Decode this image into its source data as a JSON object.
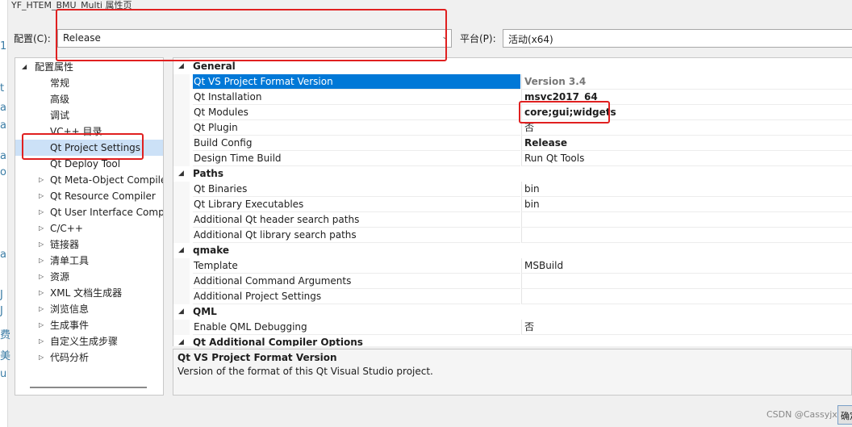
{
  "window": {
    "title": "YF_HTEM_BMU_Multi 属性页"
  },
  "config_bar": {
    "config_label": "配置(C):",
    "config_value": "Release",
    "platform_label": "平台(P):",
    "platform_value": "活动(x64)"
  },
  "tree": {
    "root": "配置属性",
    "items": [
      {
        "label": "常规"
      },
      {
        "label": "高级"
      },
      {
        "label": "调试"
      },
      {
        "label": "VC++ 目录"
      },
      {
        "label": "Qt Project Settings"
      },
      {
        "label": "Qt Deploy Tool"
      },
      {
        "label": "Qt Meta-Object Compiler"
      },
      {
        "label": "Qt Resource Compiler"
      },
      {
        "label": "Qt User Interface Compiler"
      },
      {
        "label": "C/C++"
      },
      {
        "label": "链接器"
      },
      {
        "label": "清单工具"
      },
      {
        "label": "资源"
      },
      {
        "label": "XML 文档生成器"
      },
      {
        "label": "浏览信息"
      },
      {
        "label": "生成事件"
      },
      {
        "label": "自定义生成步骤"
      },
      {
        "label": "代码分析"
      }
    ]
  },
  "grid": {
    "general": {
      "title": "General",
      "rows": [
        {
          "name": "Qt VS Project Format Version",
          "value": "Version 3.4"
        },
        {
          "name": "Qt Installation",
          "value": "msvc2017_64"
        },
        {
          "name": "Qt Modules",
          "value": "core;gui;widgets"
        },
        {
          "name": "Qt Plugin",
          "value": "否"
        },
        {
          "name": "Build Config",
          "value": "Release"
        },
        {
          "name": "Design Time Build",
          "value": "Run Qt Tools"
        }
      ]
    },
    "paths": {
      "title": "Paths",
      "rows": [
        {
          "name": "Qt Binaries",
          "value": "bin"
        },
        {
          "name": "Qt Library Executables",
          "value": "bin"
        },
        {
          "name": "Additional Qt header search paths",
          "value": ""
        },
        {
          "name": "Additional Qt library search paths",
          "value": ""
        }
      ]
    },
    "qmake": {
      "title": "qmake",
      "rows": [
        {
          "name": "Template",
          "value": "MSBuild"
        },
        {
          "name": "Additional Command Arguments",
          "value": ""
        },
        {
          "name": "Additional Project Settings",
          "value": ""
        }
      ]
    },
    "qml": {
      "title": "QML",
      "rows": [
        {
          "name": "Enable QML Debugging",
          "value": "否"
        }
      ]
    },
    "compiler": {
      "title": "Qt Additional Compiler Options"
    }
  },
  "description": {
    "title": "Qt VS Project Format Version",
    "text": "Version of the format of this Qt Visual Studio project."
  },
  "footer": {
    "watermark": "CSDN @Cassyjx",
    "ok_label": "确定"
  },
  "colors": {
    "selection": "#0078d7",
    "tree_selection": "#cce1f7",
    "annotation_red": "#e02020"
  }
}
